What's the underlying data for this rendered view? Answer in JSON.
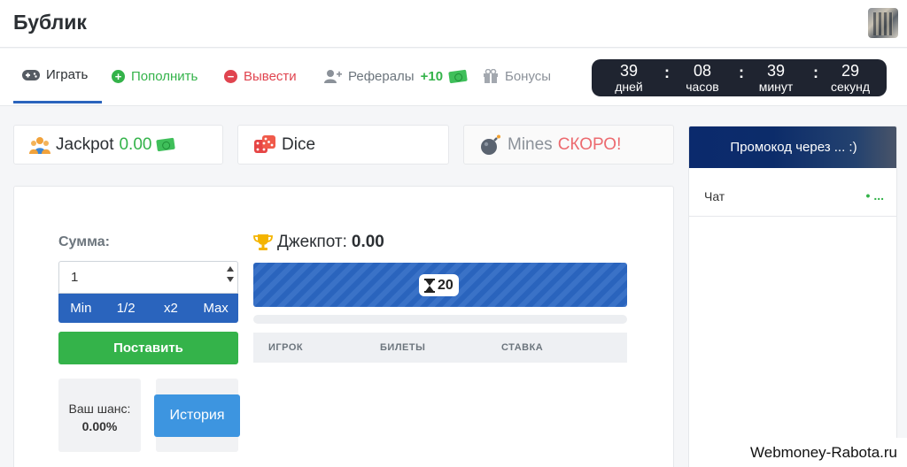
{
  "app": {
    "title": "Бублик"
  },
  "nav": {
    "play": "Играть",
    "deposit": "Пополнить",
    "withdraw": "Вывести",
    "referrals": "Рефералы",
    "referrals_count": "+10",
    "bonuses": "Бонусы"
  },
  "timer": {
    "days": "39",
    "days_label": "дней",
    "hours": "08",
    "hours_label": "часов",
    "minutes": "39",
    "minutes_label": "минут",
    "seconds": "29",
    "seconds_label": "секунд",
    "separator": ":"
  },
  "games": {
    "jackpot": "Jackpot",
    "jackpot_value": "0.00",
    "dice": "Dice",
    "mines": "Mines",
    "mines_badge": "СКОРО!"
  },
  "bet": {
    "sum_label": "Сумма:",
    "amount": "1",
    "min": "Min",
    "half": "1/2",
    "double": "x2",
    "max": "Max",
    "place": "Поставить",
    "chance_label": "Ваш шанс:",
    "chance_value": "0.00%",
    "history": "История"
  },
  "jackpot_panel": {
    "label": "Джекпот:",
    "value": "0.00",
    "countdown": "20",
    "col_player": "ИГРОК",
    "col_tickets": "БИЛЕТЫ",
    "col_bet": "СТАВКА"
  },
  "sidebar": {
    "promo": "Промокод через ... :)",
    "chat_label": "Чат",
    "chat_status": "• ..."
  },
  "watermark": "Webmoney-Rabota.ru",
  "colors": {
    "primary": "#2a64bd",
    "success": "#34b34a",
    "danger": "#e0444f",
    "timer_bg": "#1f2430"
  }
}
